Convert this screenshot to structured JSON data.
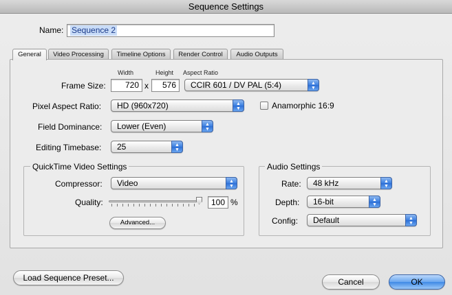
{
  "window": {
    "title": "Sequence Settings"
  },
  "name": {
    "label": "Name:",
    "value": "Sequence 2"
  },
  "tabs": [
    {
      "label": "General"
    },
    {
      "label": "Video Processing"
    },
    {
      "label": "Timeline Options"
    },
    {
      "label": "Render Control"
    },
    {
      "label": "Audio Outputs"
    }
  ],
  "general": {
    "frame_size": {
      "label": "Frame Size:",
      "width_header": "Width",
      "height_header": "Height",
      "aspect_header": "Aspect Ratio",
      "width": "720",
      "separator": "x",
      "height": "576",
      "aspect_ratio": "CCIR 601 / DV PAL (5:4)"
    },
    "pixel_aspect": {
      "label": "Pixel Aspect Ratio:",
      "value": "HD (960x720)"
    },
    "anamorphic": {
      "label": "Anamorphic 16:9",
      "checked": false
    },
    "field_dominance": {
      "label": "Field Dominance:",
      "value": "Lower (Even)"
    },
    "editing_timebase": {
      "label": "Editing Timebase:",
      "value": "25"
    },
    "quicktime": {
      "title": "QuickTime Video Settings",
      "compressor_label": "Compressor:",
      "compressor": "Video",
      "quality_label": "Quality:",
      "quality_value": "100",
      "quality_unit": "%",
      "quality_fraction": 1.0,
      "advanced_label": "Advanced..."
    },
    "audio": {
      "title": "Audio Settings",
      "rate_label": "Rate:",
      "rate": "48 kHz",
      "depth_label": "Depth:",
      "depth": "16-bit",
      "config_label": "Config:",
      "config": "Default"
    }
  },
  "footer": {
    "load_preset": "Load Sequence Preset...",
    "cancel": "Cancel",
    "ok": "OK"
  },
  "colors": {
    "accent": "#3f8ae6",
    "selection": "#c9dcf7"
  }
}
